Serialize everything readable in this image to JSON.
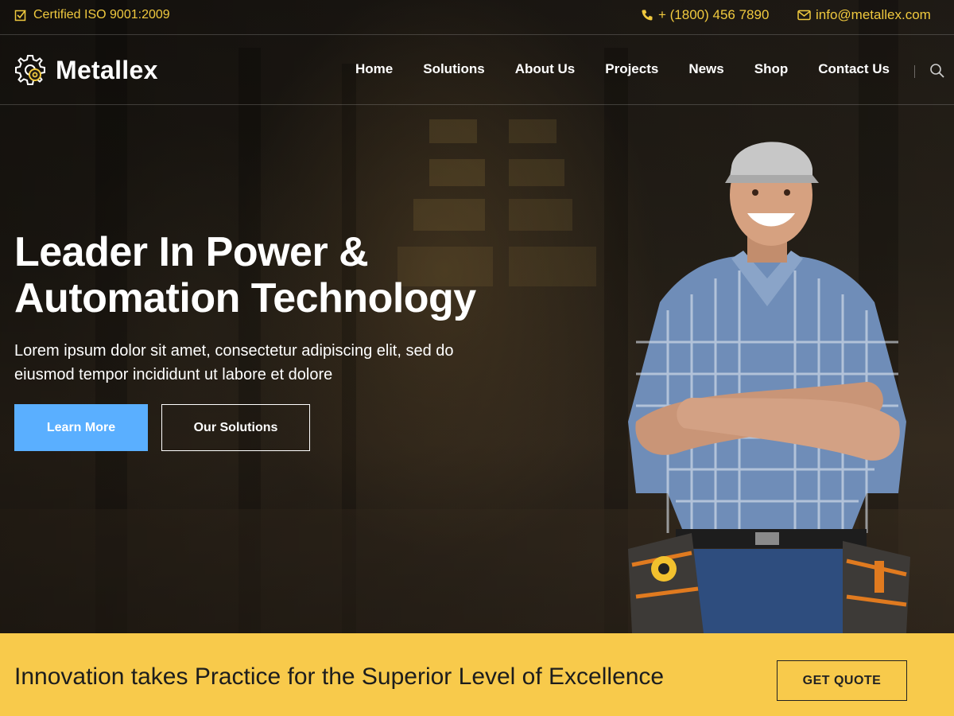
{
  "topbar": {
    "certification": "Certified ISO 9001:2009",
    "phone": "+ (1800) 456 7890",
    "email": "info@metallex.com",
    "icons": {
      "certification": "checkbox-icon",
      "phone": "phone-icon",
      "email": "envelope-icon"
    }
  },
  "brand": {
    "name": "Metallex",
    "logo_icon": "gear-icon"
  },
  "nav": {
    "items": [
      {
        "label": "Home"
      },
      {
        "label": "Solutions"
      },
      {
        "label": "About Us"
      },
      {
        "label": "Projects"
      },
      {
        "label": "News"
      },
      {
        "label": "Shop"
      },
      {
        "label": "Contact Us"
      }
    ],
    "search_icon": "search-icon"
  },
  "hero": {
    "headline_line1": "Leader In Power &",
    "headline_line2": "Automation Technology",
    "subtext": "Lorem ipsum dolor sit amet, consectetur adipiscing elit, sed do eiusmod tempor incididunt ut labore et dolore",
    "primary_button": "Learn More",
    "secondary_button": "Our Solutions"
  },
  "cta": {
    "text": "Innovation takes Practice for the Superior Level of Excellence",
    "button": "GET QUOTE"
  },
  "colors": {
    "accent_yellow": "#f0c93e",
    "cta_band": "#f8ca4b",
    "primary_button": "#5aafff",
    "text_dark": "#1d1d1d",
    "text_light": "#ffffff"
  }
}
